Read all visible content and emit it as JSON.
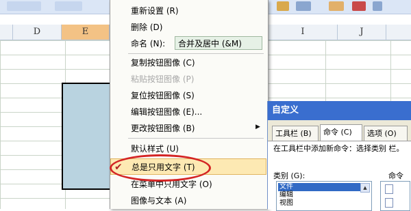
{
  "columns": [
    "D",
    "E",
    "I",
    "J"
  ],
  "menu": {
    "items": [
      {
        "label": "重新设置 (R)",
        "disabled": false
      },
      {
        "label": "删除 (D)",
        "disabled": false
      },
      {
        "label": "命名 (N):",
        "disabled": false
      },
      {
        "label": "复制按钮图像 (C)",
        "disabled": false
      },
      {
        "label": "粘贴按钮图像 (P)",
        "disabled": true
      },
      {
        "label": "复位按钮图像 (S)",
        "disabled": false
      },
      {
        "label": "编辑按钮图像 (E)...",
        "disabled": false
      },
      {
        "label": "更改按钮图像 (B)",
        "disabled": false
      },
      {
        "label": "默认样式 (U)",
        "disabled": false
      },
      {
        "label": "总是只用文字 (T)",
        "disabled": false
      },
      {
        "label": "在菜单中只用文字 (O)",
        "disabled": false
      },
      {
        "label": "图像与文本 (A)",
        "disabled": false
      }
    ],
    "name_value": "合并及居中 (&M)"
  },
  "dialog": {
    "title": "自定义",
    "tabs": [
      "工具栏 (B)",
      "命令 (C)",
      "选项 (O)"
    ],
    "description": "在工具栏中添加新命令：选择类别 栏。",
    "category_label": "类别 (G):",
    "commands_label": "命令",
    "categories": [
      "文件",
      "编辑",
      "视图"
    ]
  },
  "colors": {
    "selected_column": "#f3c285",
    "selected_cell": "#b9d3e0",
    "annotation": "#d42424",
    "dialog_title": "#3a6ecf"
  }
}
